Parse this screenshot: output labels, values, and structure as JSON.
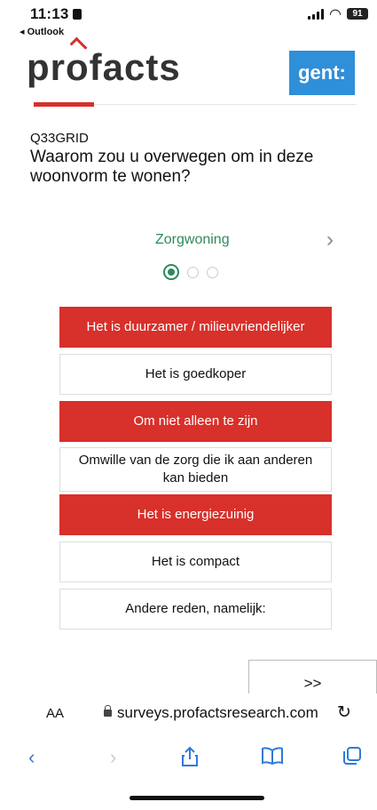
{
  "status_bar": {
    "time": "11:13",
    "back_app": "◂ Outlook",
    "battery": "91"
  },
  "header": {
    "logo": "profacts",
    "partner_logo": "gent:"
  },
  "question": {
    "code": "Q33GRID",
    "text": "Waarom zou u overwegen om in deze woonvorm te wonen?"
  },
  "carousel": {
    "current_item": "Zorgwoning",
    "page_count": 3,
    "active_index": 0
  },
  "options": [
    {
      "label": "Het is duurzamer / milieuvriendelijker",
      "selected": true
    },
    {
      "label": "Het is goedkoper",
      "selected": false
    },
    {
      "label": "Om niet alleen te zijn",
      "selected": true
    },
    {
      "label": "Omwille van de zorg die ik aan anderen kan bieden",
      "selected": false
    },
    {
      "label": "Het is energiezuinig",
      "selected": true
    },
    {
      "label": "Het is compact",
      "selected": false
    },
    {
      "label": "Andere reden, namelijk:",
      "selected": false
    }
  ],
  "next_button": {
    "label": ">>"
  },
  "browser": {
    "aa_label": "AA",
    "url": "surveys.profactsresearch.com"
  },
  "colors": {
    "accent_red": "#d8302a",
    "accent_green": "#2d8a5a",
    "gent_blue": "#2f8fd8",
    "ios_blue": "#2f7ad9"
  },
  "icons": {
    "reload": "reload-icon",
    "back": "chevron-left-icon",
    "forward": "chevron-right-icon",
    "share": "share-icon",
    "bookmarks": "book-icon",
    "tabs": "tabs-icon"
  }
}
